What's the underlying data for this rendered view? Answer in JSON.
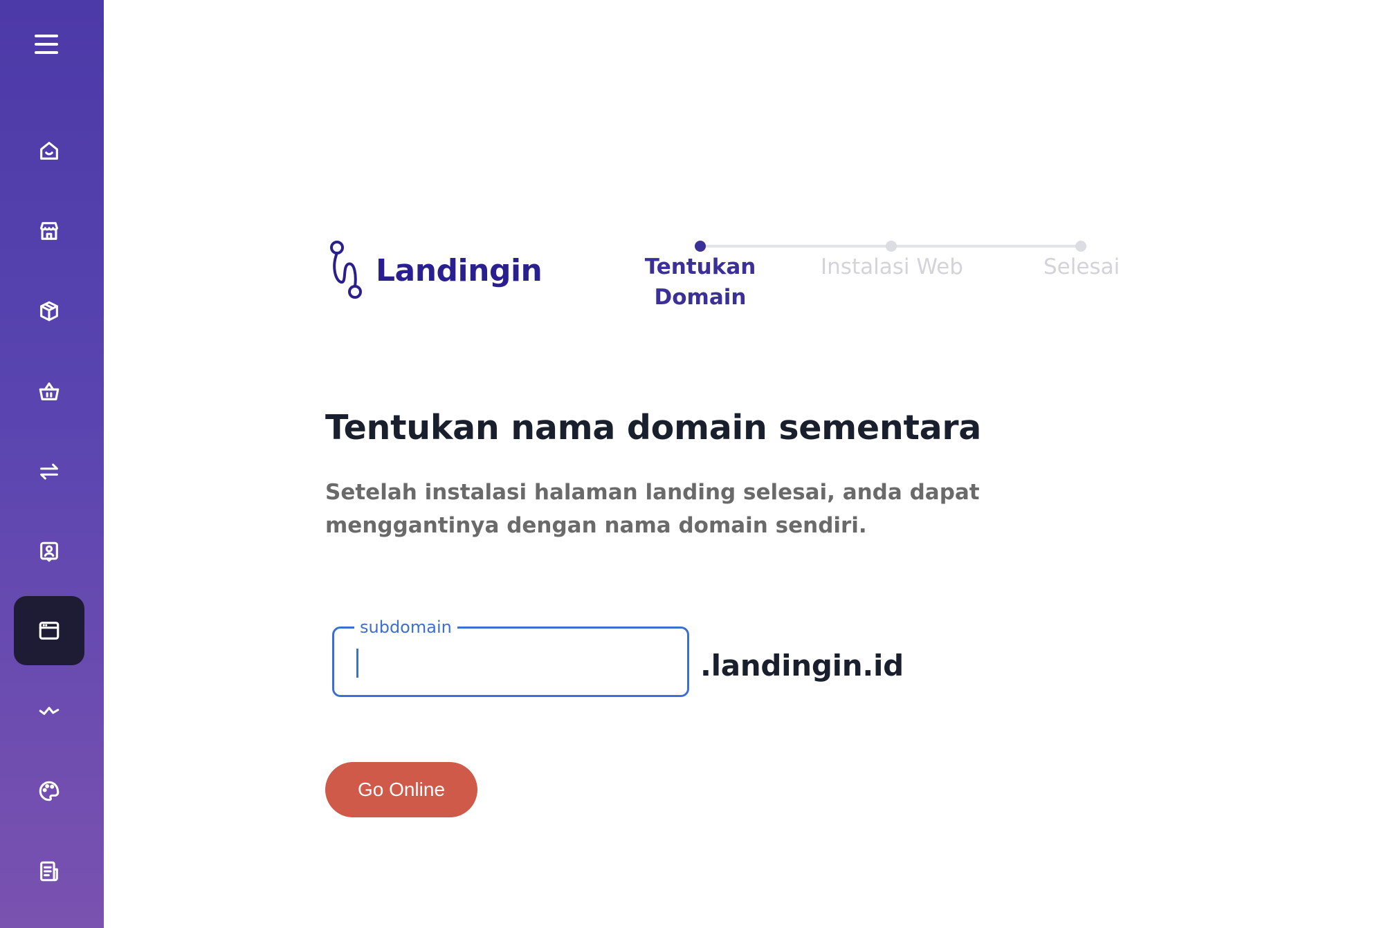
{
  "sidebar": {
    "menu_icon": "hamburger-icon",
    "items": [
      {
        "name": "home",
        "icon": "home-icon"
      },
      {
        "name": "store",
        "icon": "store-icon"
      },
      {
        "name": "products",
        "icon": "box-icon"
      },
      {
        "name": "orders",
        "icon": "basket-icon"
      },
      {
        "name": "transactions",
        "icon": "swap-icon"
      },
      {
        "name": "contacts",
        "icon": "contact-icon"
      },
      {
        "name": "landing-pages",
        "icon": "browser-window-icon",
        "active": true
      },
      {
        "name": "analytics",
        "icon": "activity-icon"
      },
      {
        "name": "theme",
        "icon": "palette-icon"
      },
      {
        "name": "reports",
        "icon": "report-icon"
      }
    ],
    "accent_color": "#4c3aa8"
  },
  "brand": {
    "name": "Landingin",
    "color": "#2a1f8f"
  },
  "stepper": {
    "steps": [
      {
        "label": "Tentukan Domain",
        "active": true
      },
      {
        "label": "Instalasi Web",
        "active": false
      },
      {
        "label": "Selesai",
        "active": false
      }
    ]
  },
  "main": {
    "title": "Tentukan nama domain sementara",
    "subtitle": "Setelah instalasi halaman landing selesai, anda dapat menggantinya dengan nama domain sendiri."
  },
  "form": {
    "subdomain_label": "subdomain",
    "subdomain_value": "",
    "suffix": ".landingin.id",
    "submit_label": "Go Online",
    "submit_color": "#d05a4a"
  }
}
